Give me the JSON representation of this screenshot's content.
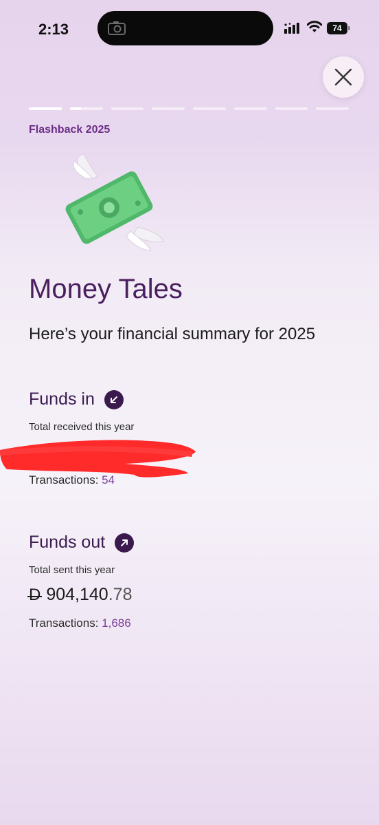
{
  "status_bar": {
    "time": "2:13",
    "battery": "74"
  },
  "story": {
    "label": "Flashback 2025",
    "progress_segments": [
      1.0,
      0.35,
      0,
      0,
      0,
      0,
      0,
      0
    ],
    "title": "Money Tales",
    "subtitle": "Here’s your financial summary for 2025"
  },
  "funds_in": {
    "title": "Funds in",
    "caption": "Total received this year",
    "transactions_label": "Transactions:",
    "transactions_count": "54"
  },
  "funds_out": {
    "title": "Funds out",
    "caption": "Total sent this year",
    "currency_symbol": "D",
    "amount_main": "904,140",
    "amount_decimal": ".78",
    "transactions_label": "Transactions:",
    "transactions_count": "1,686"
  },
  "icons": {
    "close": "close-icon",
    "funds_in": "arrow-down-left-icon",
    "funds_out": "arrow-up-right-icon",
    "hero": "flying-money-icon"
  },
  "colors": {
    "accent": "#6a2e86",
    "title": "#4a1f5f",
    "badge": "#3a1a4d",
    "redaction": "#ff2a2a"
  }
}
